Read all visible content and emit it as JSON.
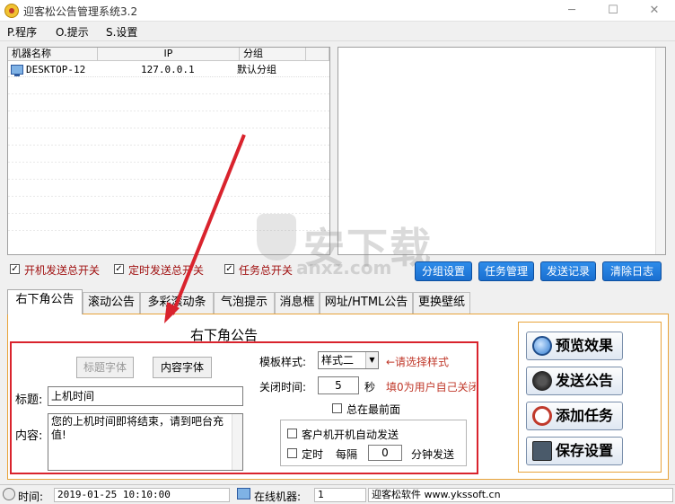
{
  "window": {
    "title": "迎客松公告管理系统3.2"
  },
  "menu": [
    "P.程序",
    "O.提示",
    "S.设置"
  ],
  "list": {
    "columns": [
      "机器名称",
      "IP",
      "分组"
    ],
    "rows": [
      {
        "name": "DESKTOP-12",
        "ip": "127.0.0.1",
        "group": "默认分组"
      }
    ]
  },
  "switches": [
    {
      "label": "开机发送总开关",
      "checked": true
    },
    {
      "label": "定时发送总开关",
      "checked": true
    },
    {
      "label": "任务总开关",
      "checked": true
    }
  ],
  "actions": [
    "分组设置",
    "任务管理",
    "发送记录",
    "清除日志"
  ],
  "tabs": [
    "右下角公告",
    "滚动公告",
    "多彩滚动条",
    "气泡提示",
    "消息框",
    "网址/HTML公告",
    "更换壁纸"
  ],
  "panel": {
    "title": "右下角公告",
    "title_font_btn": "标题字体",
    "content_font_btn": "内容字体",
    "title_label": "标题:",
    "title_value": "上机时间",
    "content_label": "内容:",
    "content_value": "您的上机时间即将结束，请到吧台充值!",
    "template_label": "模板样式:",
    "template_value": "样式二",
    "template_hint": "←请选择样式",
    "close_label": "关闭时间:",
    "close_value": "5",
    "close_unit": "秒",
    "close_hint": "填0为用户自己关闭",
    "topmost_label": "总在最前面",
    "auto_send_label": "客户机开机自动发送",
    "timer_label": "定时",
    "every_label": "每隔",
    "every_value": "0",
    "every_unit": "分钟发送"
  },
  "side_buttons": [
    {
      "label": "预览效果",
      "icon": "magnifier-icon"
    },
    {
      "label": "发送公告",
      "icon": "speaker-icon"
    },
    {
      "label": "添加任务",
      "icon": "clock-icon"
    },
    {
      "label": "保存设置",
      "icon": "floppy-icon"
    }
  ],
  "status": {
    "time_label": "时间:",
    "time_value": "2019-01-25 10:10:00",
    "online_label": "在线机器:",
    "online_value": "1",
    "vendor": "迎客松软件 www.ykssoft.cn"
  },
  "watermark": {
    "text": "安下载",
    "sub": "anxz.com"
  },
  "colors": {
    "accent": "#1a6fd0",
    "red": "#d9232d",
    "tab_border": "#e8a33a"
  }
}
